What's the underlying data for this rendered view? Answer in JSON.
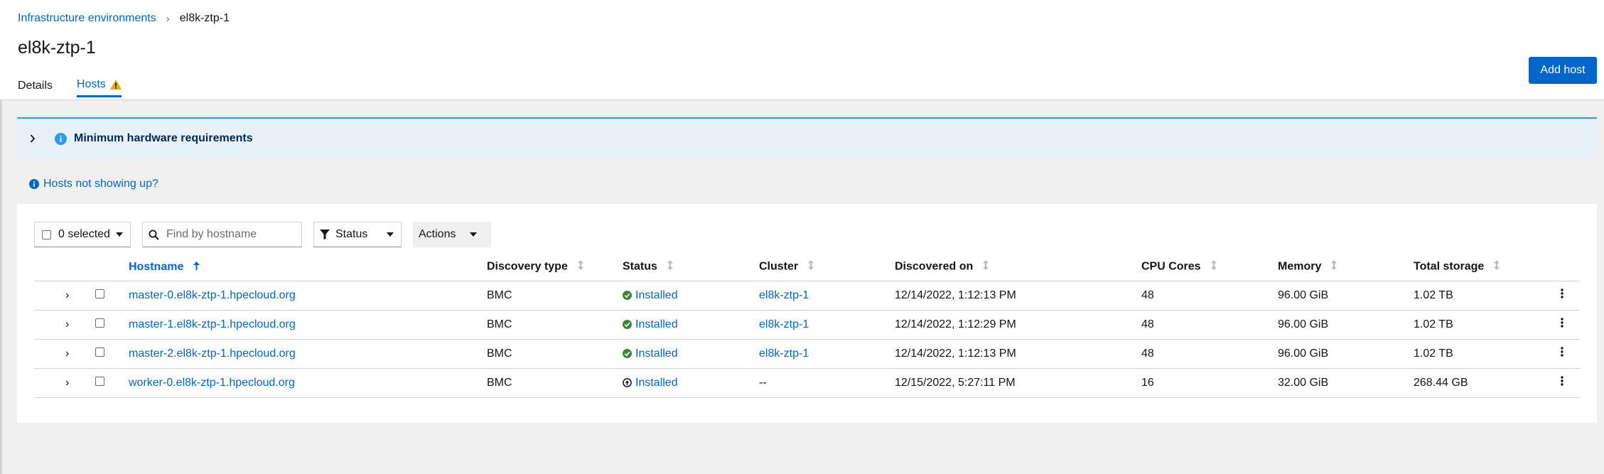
{
  "breadcrumb": {
    "parent": "Infrastructure environments",
    "current": "el8k-ztp-1"
  },
  "page_title": "el8k-ztp-1",
  "tabs": [
    {
      "label": "Details",
      "active": false
    },
    {
      "label": "Hosts",
      "active": true,
      "icon": "warning-triangle-icon"
    }
  ],
  "add_host_label": "Add host",
  "alert": {
    "title": "Minimum hardware requirements",
    "icon": "info-circle-icon"
  },
  "help_link": "Hosts not showing up?",
  "toolbar": {
    "selected_label": "0 selected",
    "search_placeholder": "Find by hostname",
    "status_label": "Status",
    "actions_label": "Actions"
  },
  "table": {
    "columns": [
      "Hostname",
      "Discovery type",
      "Status",
      "Cluster",
      "Discovered on",
      "CPU Cores",
      "Memory",
      "Total storage"
    ],
    "sorted_column": "Hostname",
    "rows": [
      {
        "hostname": "master-0.el8k-ztp-1.hpecloud.org",
        "discovery": "BMC",
        "status": "Installed",
        "status_icon": "check-circle-icon",
        "cluster": "el8k-ztp-1",
        "discovered": "12/14/2022, 1:12:13 PM",
        "cpu": "48",
        "memory": "96.00 GiB",
        "storage": "1.02 TB"
      },
      {
        "hostname": "master-1.el8k-ztp-1.hpecloud.org",
        "discovery": "BMC",
        "status": "Installed",
        "status_icon": "check-circle-icon",
        "cluster": "el8k-ztp-1",
        "discovered": "12/14/2022, 1:12:29 PM",
        "cpu": "48",
        "memory": "96.00 GiB",
        "storage": "1.02 TB"
      },
      {
        "hostname": "master-2.el8k-ztp-1.hpecloud.org",
        "discovery": "BMC",
        "status": "Installed",
        "status_icon": "check-circle-icon",
        "cluster": "el8k-ztp-1",
        "discovered": "12/14/2022, 1:12:13 PM",
        "cpu": "48",
        "memory": "96.00 GiB",
        "storage": "1.02 TB"
      },
      {
        "hostname": "worker-0.el8k-ztp-1.hpecloud.org",
        "discovery": "BMC",
        "status": "Installed",
        "status_icon": "arrow-circle-icon",
        "cluster": "--",
        "discovered": "12/15/2022, 5:27:11 PM",
        "cpu": "16",
        "memory": "32.00 GiB",
        "storage": "268.44 GB"
      }
    ]
  },
  "colors": {
    "link": "#0066cc",
    "primary_button": "#0066cc",
    "success": "#3e8635",
    "warning": "#f0ab00",
    "info": "#2b9af3",
    "alert_bg": "#e7f1fa"
  }
}
